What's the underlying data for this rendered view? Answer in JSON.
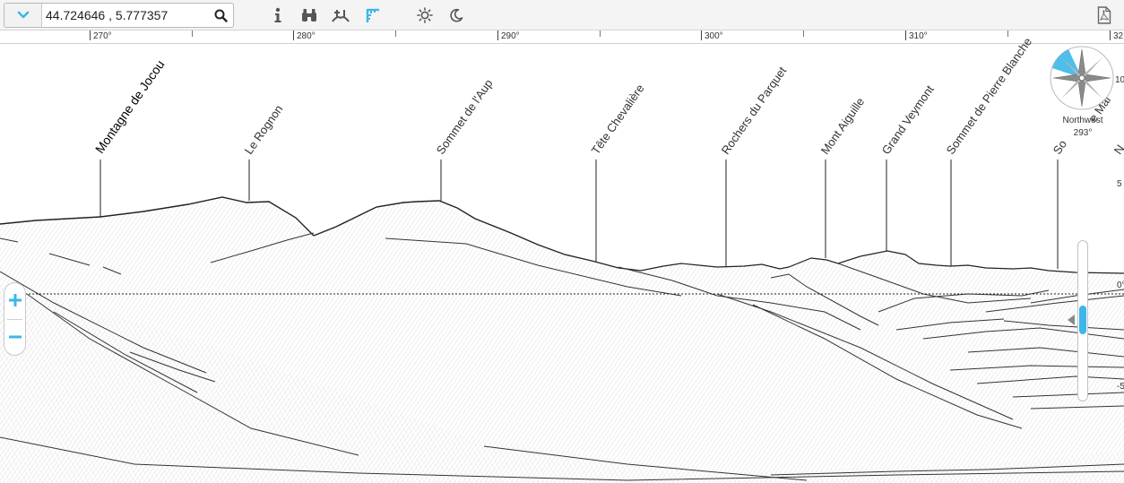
{
  "toolbar": {
    "location_value": "44.724646 , 5.777357",
    "dropdown_icon": "chevron-down-icon",
    "search_icon": "search-icon",
    "tools": [
      "info-icon",
      "binoculars-icon",
      "horizon-icon",
      "distance-icon",
      "sun-icon",
      "moon-icon"
    ],
    "export_icon": "pdf-icon",
    "accent_color": "#3bb7e9"
  },
  "ruler": {
    "labels": [
      "270°",
      "280°",
      "290°",
      "300°",
      "310°",
      "32"
    ]
  },
  "peaks": [
    "Montagne de Jocou",
    "Le Rognon",
    "Sommet de l'Aup",
    "Tête Chevalière",
    "Rochers du Parquet",
    "Mont Aiguille",
    "Grand Veymont",
    "Sommet de Pierre Blanche",
    "So",
    "e Mal",
    "N"
  ],
  "compass": {
    "direction": "Northwest",
    "bearing": "293°"
  },
  "elevation_labels": [
    "10",
    "5",
    "0°",
    "-5"
  ],
  "zoom": {
    "plus": "+",
    "minus": "−"
  }
}
